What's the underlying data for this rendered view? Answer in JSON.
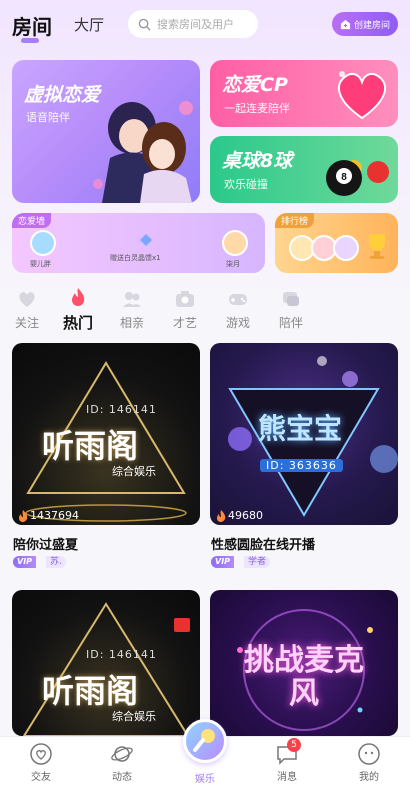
{
  "header": {
    "tabs": [
      {
        "label": "房间"
      },
      {
        "label": "大厅"
      }
    ],
    "search_placeholder": "搜索房间及用户",
    "create_room_label": "创建房间"
  },
  "banners": {
    "virtual_love": {
      "title": "虚拟恋爱",
      "subtitle": "语音陪伴"
    },
    "love_cp": {
      "title": "恋爱CP",
      "subtitle": "一起连麦陪伴"
    },
    "billiards": {
      "title": "桌球8球",
      "subtitle": "欢乐碰撞"
    }
  },
  "love_wall": {
    "label": "恋爱墙",
    "left_user": "婴儿胖",
    "message": "赠送白灵晶馈x1",
    "right_user": "柒月"
  },
  "rank": {
    "label": "排行榜"
  },
  "categories": [
    {
      "label": "关注",
      "icon": "heart-icon"
    },
    {
      "label": "热门",
      "icon": "flame-icon"
    },
    {
      "label": "相亲",
      "icon": "couple-icon"
    },
    {
      "label": "才艺",
      "icon": "camera-icon"
    },
    {
      "label": "游戏",
      "icon": "gamepad-icon"
    },
    {
      "label": "陪伴",
      "icon": "chat-icon"
    }
  ],
  "rooms": [
    {
      "title": "陪你过盛夏",
      "hot": "1437694",
      "vip": "VIP",
      "tag": "苏.",
      "poster_main": "听雨阁",
      "poster_id": "ID: 146141",
      "poster_sub": "综合娱乐"
    },
    {
      "title": "性感圆脸在线开播",
      "hot": "49680",
      "vip": "VIP",
      "tag": "学者",
      "poster_main": "熊宝宝",
      "poster_id": "ID: 363636",
      "poster_sub": ""
    },
    {
      "poster_main": "听雨阁",
      "poster_id": "ID: 146141",
      "poster_sub": "综合娱乐"
    },
    {
      "poster_main": "挑战麦克风"
    }
  ],
  "bottom_nav": [
    {
      "label": "交友"
    },
    {
      "label": "动态"
    },
    {
      "label": "娱乐"
    },
    {
      "label": "消息",
      "badge": "5"
    },
    {
      "label": "我的"
    }
  ],
  "colors": {
    "accent": "#a07bf7",
    "badge": "#f4434d"
  }
}
